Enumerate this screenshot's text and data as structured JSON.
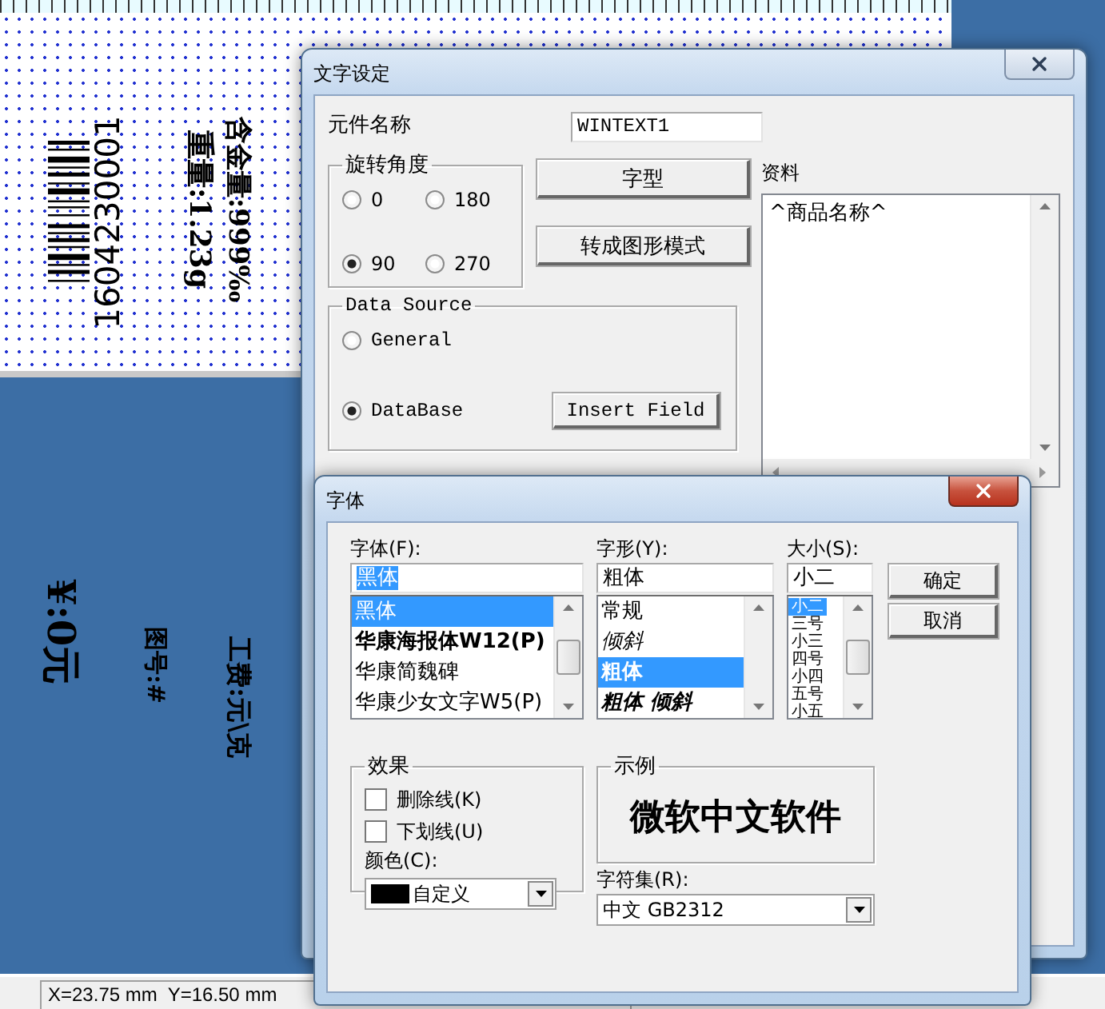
{
  "canvas": {
    "items": [
      {
        "kind": "barcode",
        "text": "1604230001"
      },
      {
        "kind": "text",
        "text": "重量:1.23g"
      },
      {
        "kind": "text",
        "text": "含金量:999‰"
      },
      {
        "kind": "text",
        "text": "¥:0元"
      },
      {
        "kind": "text",
        "text": "图号:#"
      },
      {
        "kind": "text",
        "text": "工费:元\\克"
      }
    ]
  },
  "text_dialog": {
    "title": "文字设定",
    "active": false,
    "name_label": "元件名称",
    "name_value": "WINTEXT1",
    "rotation": {
      "label": "旋转角度",
      "options": [
        {
          "label": "0",
          "selected": false
        },
        {
          "label": "180",
          "selected": false
        },
        {
          "label": "90",
          "selected": true
        },
        {
          "label": "270",
          "selected": false
        }
      ]
    },
    "font_button": "字型",
    "graphic_button": "转成图形模式",
    "data_source": {
      "label": "Data Source",
      "options": [
        {
          "label": "General",
          "selected": false
        },
        {
          "label": "DataBase",
          "selected": true
        }
      ],
      "insert_button": "Insert Field"
    },
    "data_label": "资料",
    "data_value": "^商品名称^"
  },
  "font_dialog": {
    "title": "字体",
    "active": true,
    "font": {
      "label": "字体(F):",
      "value": "黑体",
      "value_selected": true,
      "items": [
        {
          "label": "黑体",
          "kind": "regular",
          "selected": true
        },
        {
          "label": "华康海报体W12(P)",
          "kind": "heavy",
          "selected": false
        },
        {
          "label": "华康简魏碑",
          "kind": "regular",
          "selected": false
        },
        {
          "label": "华康少女文字W5(P)",
          "kind": "regular",
          "selected": false
        }
      ]
    },
    "style": {
      "label": "字形(Y):",
      "value": "粗体",
      "items": [
        {
          "label": "常规",
          "kind": "regular",
          "selected": false
        },
        {
          "label": "倾斜",
          "kind": "italic",
          "selected": false
        },
        {
          "label": "粗体",
          "kind": "bold",
          "selected": true
        },
        {
          "label": "粗体 倾斜",
          "kind": "bold-italic",
          "selected": false
        }
      ]
    },
    "size": {
      "label": "大小(S):",
      "value": "小二",
      "items": [
        {
          "label": "小二",
          "selected": true
        },
        {
          "label": "三号",
          "selected": false
        },
        {
          "label": "小三",
          "selected": false
        },
        {
          "label": "四号",
          "selected": false
        },
        {
          "label": "小四",
          "selected": false
        },
        {
          "label": "五号",
          "selected": false
        },
        {
          "label": "小五",
          "selected": false
        }
      ]
    },
    "buttons": [
      "确定",
      "取消"
    ],
    "effects": {
      "label": "效果",
      "checkboxes": [
        {
          "label": "删除线(K)",
          "checked": false
        },
        {
          "label": "下划线(U)",
          "checked": false
        }
      ],
      "color_label": "颜色(C):",
      "color_value": "自定义",
      "color": "#000000"
    },
    "sample": {
      "label": "示例",
      "text": "微软中文软件"
    },
    "charset": {
      "label": "字符集(R):",
      "value": "中文 GB2312"
    }
  },
  "status_bar": {
    "coords": "X=23.75 mm  Y=16.50 mm"
  }
}
